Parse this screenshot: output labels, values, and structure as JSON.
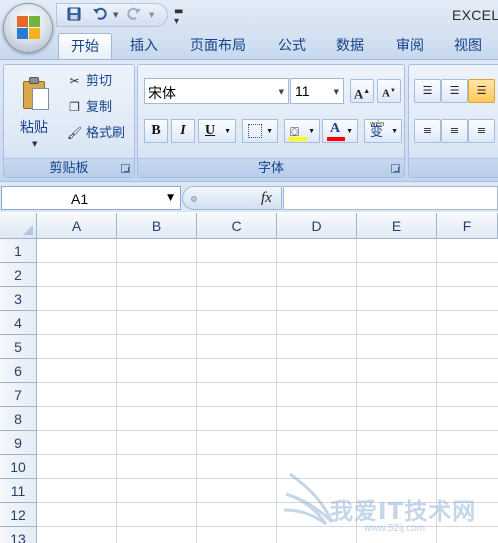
{
  "app": {
    "title": "EXCEL"
  },
  "tabs": [
    {
      "label": "开始",
      "active": true
    },
    {
      "label": "插入"
    },
    {
      "label": "页面布局"
    },
    {
      "label": "公式"
    },
    {
      "label": "数据"
    },
    {
      "label": "审阅"
    },
    {
      "label": "视图"
    }
  ],
  "clipboard": {
    "group_label": "剪贴板",
    "paste_label": "粘贴",
    "cut_label": "剪切",
    "copy_label": "复制",
    "format_painter_label": "格式刷"
  },
  "font": {
    "group_label": "字体",
    "font_name": "宋体",
    "font_size": "11",
    "bold_label": "B",
    "italic_label": "I",
    "underline_label": "U",
    "font_color_label": "A",
    "phonetic_label": "wén",
    "phonetic_char": "变",
    "fill_color": "#ffff00",
    "font_color": "#ff0000"
  },
  "formula_bar": {
    "name_box_value": "A1",
    "fx_label": "fx",
    "formula_value": ""
  },
  "grid": {
    "columns": [
      "A",
      "B",
      "C",
      "D",
      "E",
      "F"
    ],
    "rows": [
      "1",
      "2",
      "3",
      "4",
      "5",
      "6",
      "7",
      "8",
      "9",
      "10",
      "11",
      "12",
      "13"
    ]
  },
  "watermark": {
    "text": "我爱IT技术网",
    "url": "www.52ij.com"
  },
  "colors": {
    "ribbon_bg": "#d1dff2",
    "tab_text": "#15428b",
    "gridline": "#d0d7e5",
    "header_border": "#9eb6ce"
  }
}
